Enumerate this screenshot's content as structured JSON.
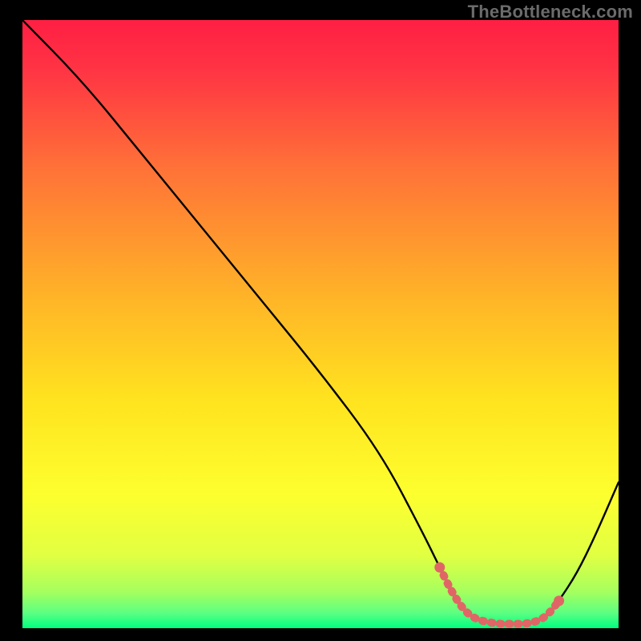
{
  "watermark": "TheBottleneck.com",
  "chart_data": {
    "type": "line",
    "title": "",
    "xlabel": "",
    "ylabel": "",
    "xlim": [
      0,
      100
    ],
    "ylim": [
      0,
      100
    ],
    "x": [
      0,
      10,
      20,
      30,
      40,
      50,
      60,
      67,
      70,
      72,
      74,
      76,
      78,
      80,
      82,
      84,
      86,
      88,
      90,
      93,
      96,
      100
    ],
    "values": [
      100,
      90,
      78,
      66,
      54,
      42,
      29,
      16,
      10,
      6,
      3,
      1.5,
      1,
      0.7,
      0.7,
      0.7,
      1,
      2,
      4.5,
      9,
      15,
      24
    ],
    "highlight_segment": {
      "x_start": 70,
      "x_end": 90
    },
    "gradient_stops": [
      {
        "offset": 0.0,
        "color": "#ff1f43"
      },
      {
        "offset": 0.08,
        "color": "#ff3344"
      },
      {
        "offset": 0.25,
        "color": "#ff7437"
      },
      {
        "offset": 0.45,
        "color": "#ffb228"
      },
      {
        "offset": 0.62,
        "color": "#ffe21f"
      },
      {
        "offset": 0.78,
        "color": "#fdff2e"
      },
      {
        "offset": 0.88,
        "color": "#e1ff42"
      },
      {
        "offset": 0.94,
        "color": "#a6ff5e"
      },
      {
        "offset": 0.975,
        "color": "#5cff82"
      },
      {
        "offset": 1.0,
        "color": "#00ff7f"
      }
    ],
    "highlight_color": "#e06666",
    "line_color": "#000000"
  }
}
